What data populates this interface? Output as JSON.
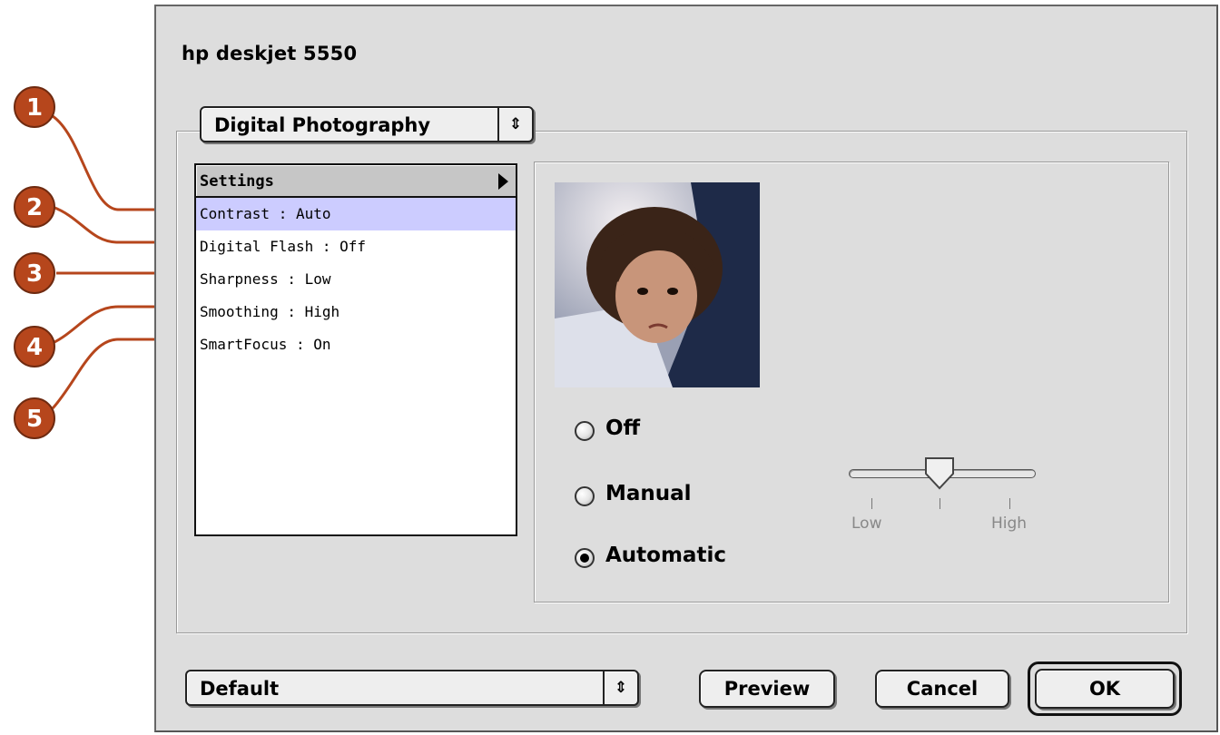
{
  "window": {
    "title": "hp deskjet 5550"
  },
  "panel_select": {
    "value": "Digital Photography",
    "arrows": "⇕"
  },
  "settings_list": {
    "header": "Settings",
    "items": [
      {
        "label": "Contrast : Auto",
        "selected": true
      },
      {
        "label": "Digital Flash : Off",
        "selected": false
      },
      {
        "label": "Sharpness : Low",
        "selected": false
      },
      {
        "label": "Smoothing : High",
        "selected": false
      },
      {
        "label": "SmartFocus : On",
        "selected": false
      }
    ]
  },
  "contrast": {
    "options": [
      {
        "label": "Off",
        "checked": false
      },
      {
        "label": "Manual",
        "checked": false
      },
      {
        "label": "Automatic",
        "checked": true
      }
    ],
    "slider": {
      "low_label": "Low",
      "high_label": "High",
      "value_fraction": 0.5
    }
  },
  "preset_select": {
    "value": "Default",
    "arrows": "⇕"
  },
  "buttons": {
    "preview": "Preview",
    "cancel": "Cancel",
    "ok": "OK"
  },
  "callouts": [
    "1",
    "2",
    "3",
    "4",
    "5"
  ],
  "colors": {
    "callout": "#b6461c",
    "dialog_bg": "#dddddd",
    "list_selection": "#ccccff"
  }
}
